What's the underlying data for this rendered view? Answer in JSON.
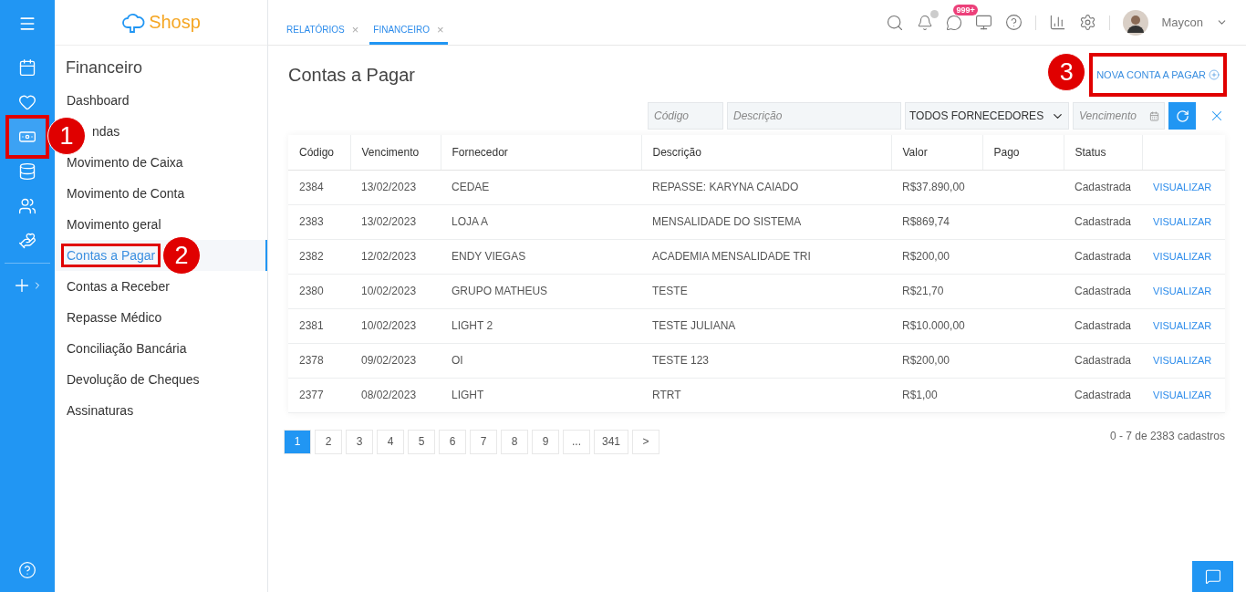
{
  "rail": {
    "items": [
      {
        "selected": false
      },
      {
        "selected": false
      },
      {
        "selected": true,
        "annotation": "1"
      },
      {
        "selected": false
      },
      {
        "selected": false
      },
      {
        "selected": false
      }
    ]
  },
  "logo": {
    "text": "Shosp"
  },
  "sidebar": {
    "title": "Financeiro",
    "items": [
      {
        "label": "Dashboard",
        "selected": false
      },
      {
        "label": "ndas",
        "selected": false,
        "covered": true
      },
      {
        "label": "Movimento de Caixa",
        "selected": false
      },
      {
        "label": "Movimento de Conta",
        "selected": false
      },
      {
        "label": "Movimento geral",
        "selected": false
      },
      {
        "label": "Contas a Pagar",
        "selected": true,
        "annotation": "2"
      },
      {
        "label": "Contas a Receber",
        "selected": false
      },
      {
        "label": "Repasse Médico",
        "selected": false
      },
      {
        "label": "Conciliação Bancária",
        "selected": false
      },
      {
        "label": "Devolução de Cheques",
        "selected": false
      },
      {
        "label": "Assinaturas",
        "selected": false
      }
    ]
  },
  "tabs": [
    {
      "label": "RELATÓRIOS",
      "close": "×",
      "selected": false
    },
    {
      "label": "FINANCEIRO",
      "close": "×",
      "selected": true
    }
  ],
  "header": {
    "messages_badge": "999+",
    "user": "Maycon"
  },
  "page": {
    "title": "Contas a Pagar",
    "new_button": {
      "label": "NOVA CONTA A PAGAR",
      "annotation": "3"
    }
  },
  "filters": {
    "code": {
      "placeholder": "Código"
    },
    "description": {
      "placeholder": "Descrição"
    },
    "supplier": {
      "value": "TODOS FORNECEDORES"
    },
    "due": {
      "placeholder": "Vencimento"
    }
  },
  "table": {
    "columns": [
      "Código",
      "Vencimento",
      "Fornecedor",
      "Descrição",
      "Valor",
      "Pago",
      "Status"
    ],
    "rows": [
      {
        "code": "2384",
        "due": "13/02/2023",
        "supplier": "CEDAE",
        "description": "REPASSE: KARYNA CAIADO",
        "value": "R$37.890,00",
        "status": "Cadastrada",
        "action": "VISUALIZAR"
      },
      {
        "code": "2383",
        "due": "13/02/2023",
        "supplier": "LOJA A",
        "description": "MENSALIDADE DO SISTEMA",
        "value": "R$869,74",
        "status": "Cadastrada",
        "action": "VISUALIZAR"
      },
      {
        "code": "2382",
        "due": "12/02/2023",
        "supplier": "ENDY VIEGAS",
        "description": "ACADEMIA MENSALIDADE TRI",
        "value": "R$200,00",
        "status": "Cadastrada",
        "action": "VISUALIZAR"
      },
      {
        "code": "2380",
        "due": "10/02/2023",
        "supplier": "GRUPO MATHEUS",
        "description": "TESTE",
        "value": "R$21,70",
        "status": "Cadastrada",
        "action": "VISUALIZAR"
      },
      {
        "code": "2381",
        "due": "10/02/2023",
        "supplier": "LIGHT 2",
        "description": "TESTE JULIANA",
        "value": "R$10.000,00",
        "status": "Cadastrada",
        "action": "VISUALIZAR"
      },
      {
        "code": "2378",
        "due": "09/02/2023",
        "supplier": "OI",
        "description": "TESTE 123",
        "value": "R$200,00",
        "status": "Cadastrada",
        "action": "VISUALIZAR"
      },
      {
        "code": "2377",
        "due": "08/02/2023",
        "supplier": "LIGHT",
        "description": "RTRT",
        "value": "R$1,00",
        "status": "Cadastrada",
        "action": "VISUALIZAR"
      }
    ]
  },
  "pagination": {
    "pages": [
      {
        "label": "1",
        "selected": true
      },
      {
        "label": "2",
        "selected": false
      },
      {
        "label": "3",
        "selected": false
      },
      {
        "label": "4",
        "selected": false
      },
      {
        "label": "5",
        "selected": false
      },
      {
        "label": "6",
        "selected": false
      },
      {
        "label": "7",
        "selected": false
      },
      {
        "label": "8",
        "selected": false
      },
      {
        "label": "9",
        "selected": false
      },
      {
        "label": "...",
        "selected": false
      },
      {
        "label": "341",
        "selected": false
      },
      {
        "label": ">",
        "selected": false
      }
    ],
    "summary": "0 - 7 de 2383 cadastros"
  }
}
